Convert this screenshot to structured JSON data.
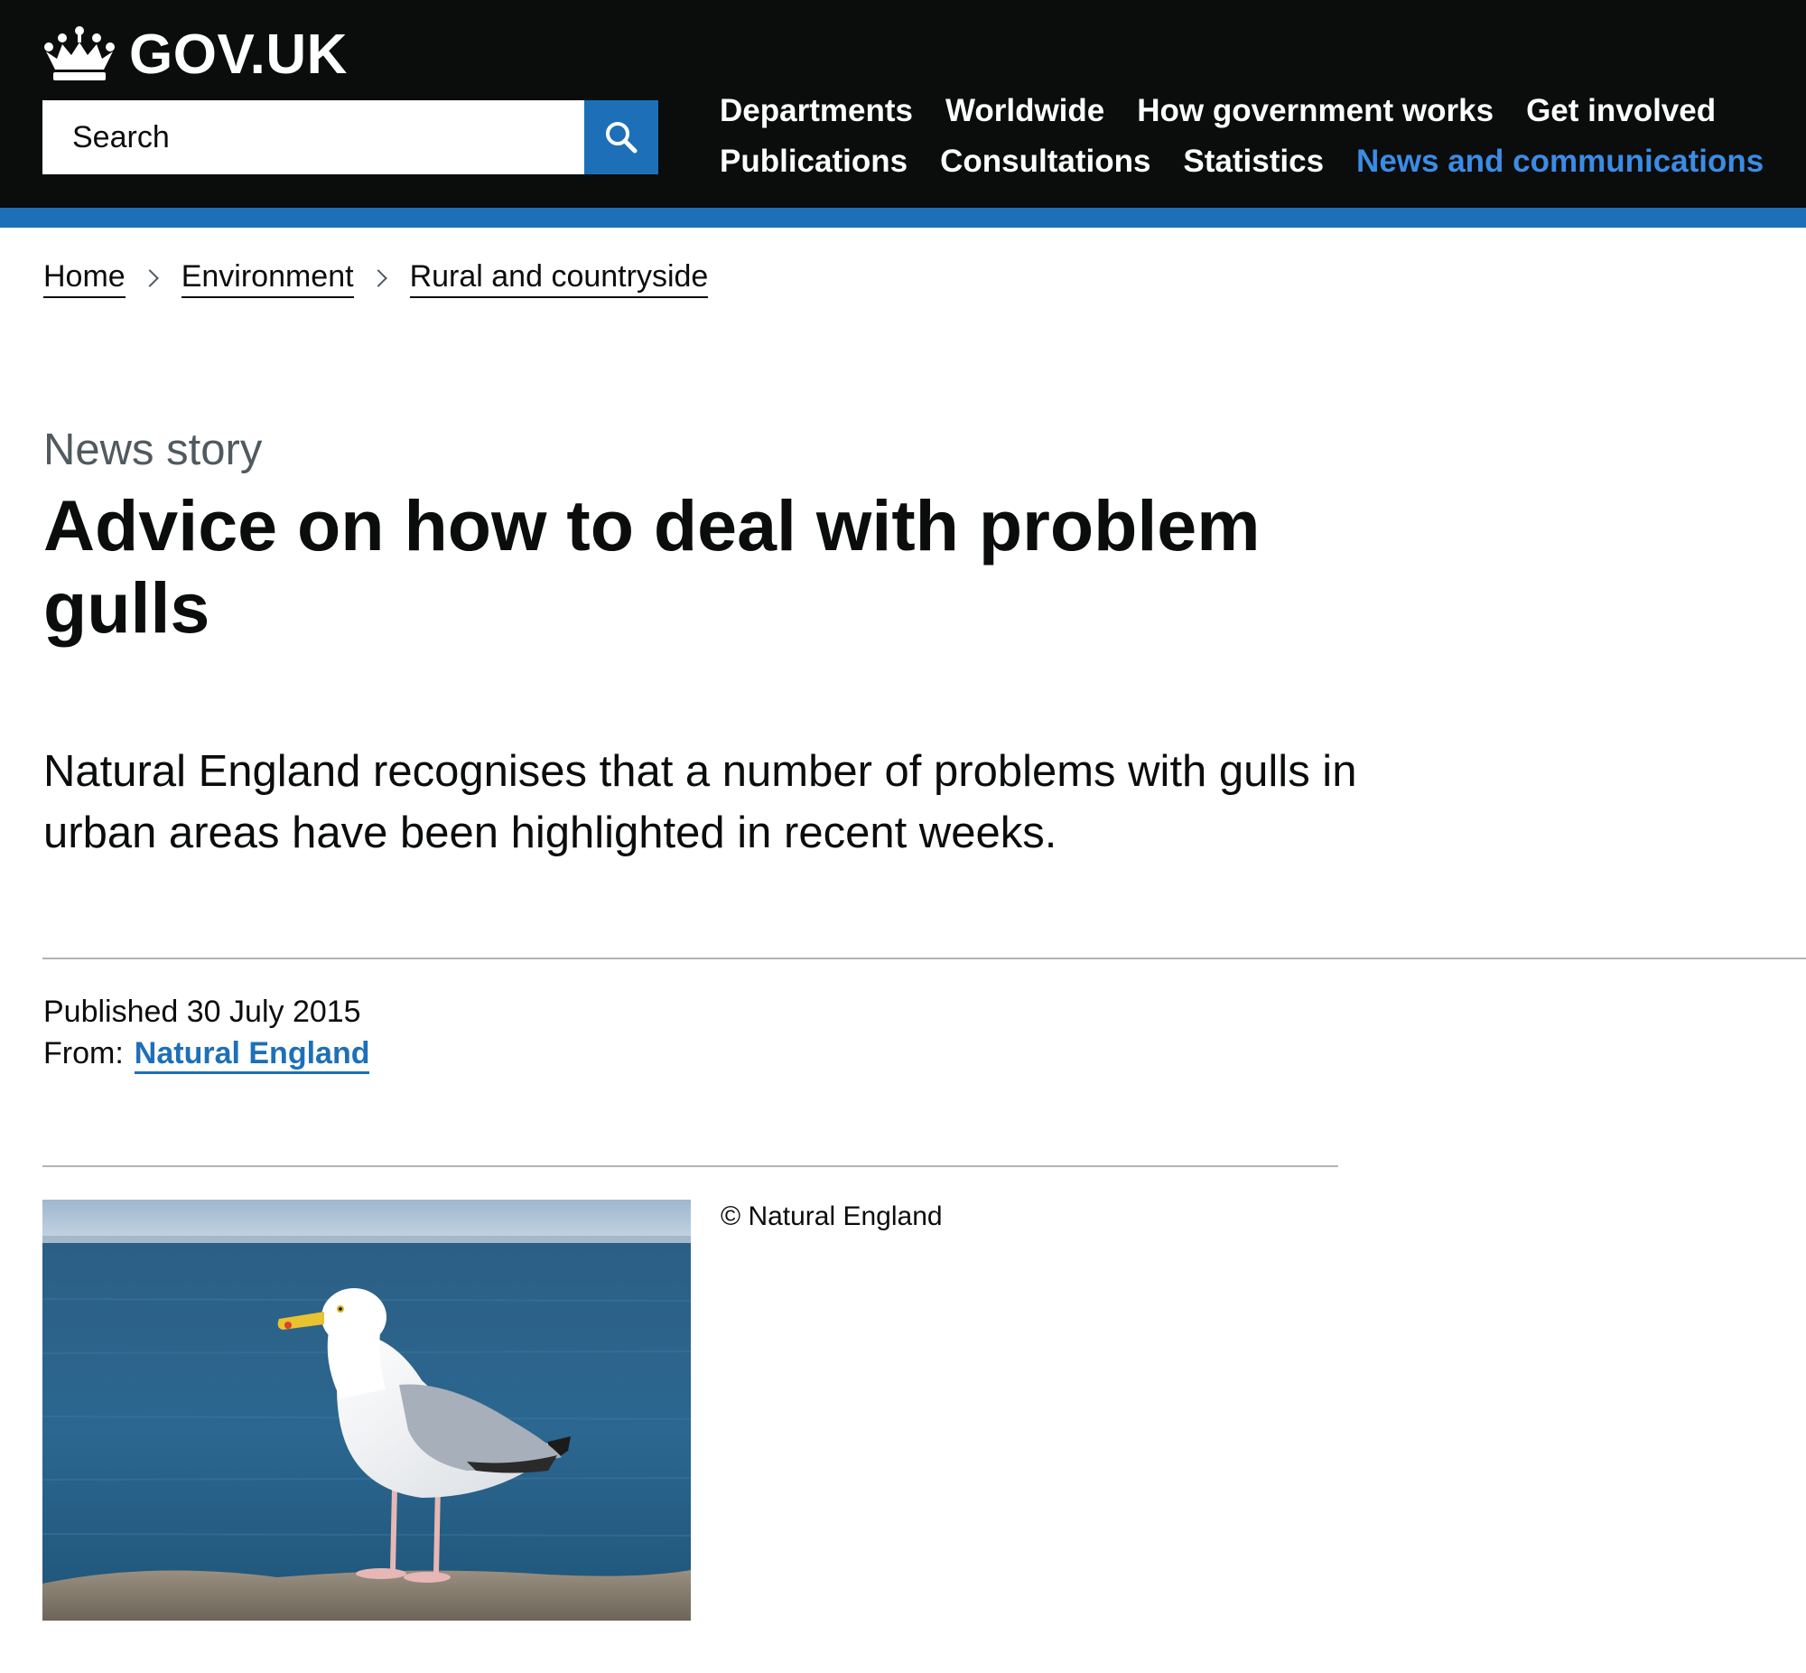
{
  "header": {
    "logo_text": "GOV.UK",
    "search_placeholder": "Search",
    "nav": [
      {
        "label": "Departments",
        "active": false
      },
      {
        "label": "Worldwide",
        "active": false
      },
      {
        "label": "How government works",
        "active": false
      },
      {
        "label": "Get involved",
        "active": false
      },
      {
        "label": "Publications",
        "active": false
      },
      {
        "label": "Consultations",
        "active": false
      },
      {
        "label": "Statistics",
        "active": false
      },
      {
        "label": "News and communications",
        "active": true
      }
    ],
    "accent_color": "#1d70b8"
  },
  "breadcrumb": [
    "Home",
    "Environment",
    "Rural and countryside"
  ],
  "article": {
    "caption": "News story",
    "title": "Advice on how to deal with problem gulls",
    "lead": "Natural England recognises that a number of problems with gulls in urban areas have been highlighted in recent weeks.",
    "published": "Published 30 July 2015",
    "from_label": "From:",
    "from_org": "Natural England",
    "image_credit": "© Natural England"
  }
}
